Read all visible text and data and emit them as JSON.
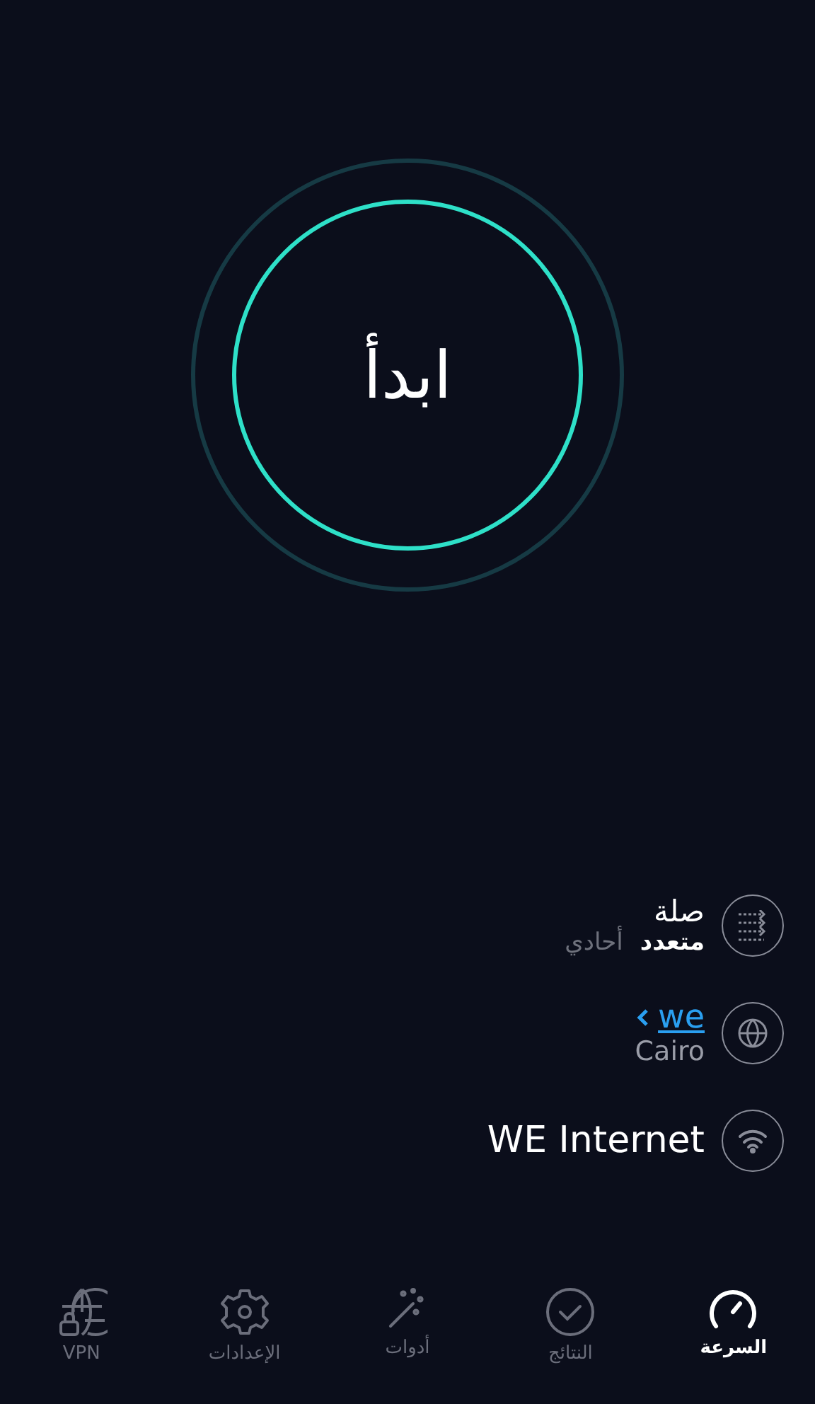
{
  "start_button": {
    "label": "ابدأ"
  },
  "connections": {
    "title": "صلة",
    "modes": [
      {
        "label": "متعدد",
        "selected": true
      },
      {
        "label": "أحادي",
        "selected": false
      }
    ]
  },
  "server": {
    "name": "we",
    "location": "Cairo"
  },
  "network": {
    "name": "WE Internet"
  },
  "tabs": [
    {
      "label": "السرعة",
      "kind": "speed",
      "selected": true
    },
    {
      "label": "النتائج",
      "kind": "results",
      "selected": false
    },
    {
      "label": "أدوات",
      "kind": "tools",
      "selected": false
    },
    {
      "label": "الإعدادات",
      "kind": "settings",
      "selected": false
    },
    {
      "label": "VPN",
      "kind": "vpn",
      "selected": false
    }
  ]
}
